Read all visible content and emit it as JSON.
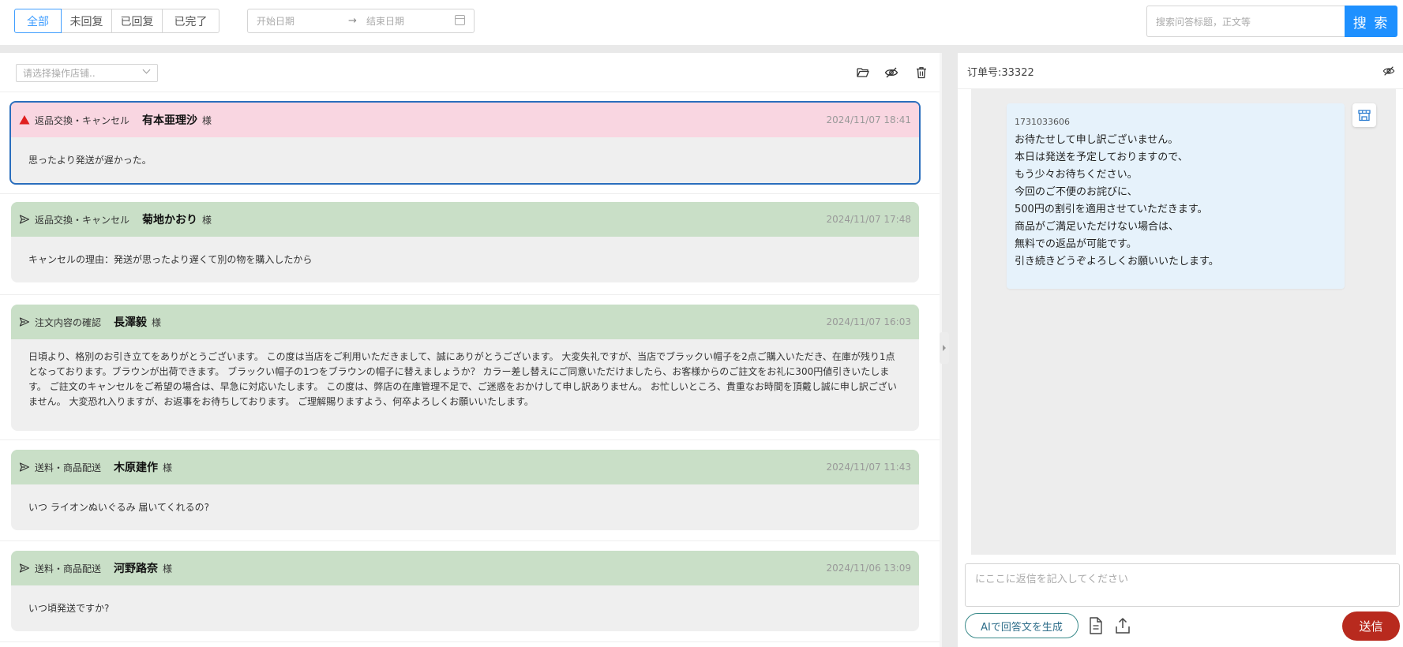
{
  "filters": {
    "tabs": [
      {
        "label": "全部"
      },
      {
        "label": "未回复"
      },
      {
        "label": "已回复"
      },
      {
        "label": "已完了"
      }
    ],
    "date_start_placeholder": "开始日期",
    "date_arrow": "→",
    "date_end_placeholder": "结束日期"
  },
  "search": {
    "placeholder": "搜索问答标题，正文等",
    "button_label": "搜 索"
  },
  "left_panel": {
    "shop_select_placeholder": "请选择操作店铺.."
  },
  "messages": [
    {
      "status": "alert",
      "category": "返品交換・キャンセル",
      "customer": "有本亜理沙",
      "honorific": "様",
      "time": "2024/11/07 18:41",
      "body": "思ったより発送が遅かった。",
      "selected": true
    },
    {
      "status": "sent",
      "category": "返品交換・キャンセル",
      "customer": "菊地かおり",
      "honorific": "様",
      "time": "2024/11/07 17:48",
      "body": "キャンセルの理由：発送が思ったより遅くて別の物を購入したから",
      "selected": false
    },
    {
      "status": "sent",
      "category": "注文内容の確認",
      "customer": "長澤毅",
      "honorific": "様",
      "time": "2024/11/07 16:03",
      "body": "日頃より、格別のお引き立てをありがとうございます。 この度は当店をご利用いただきまして、誠にありがとうございます。 大変失礼ですが、当店でブラックい帽子を2点ご購入いただき、在庫が残り1点となっております。ブラウンが出荷できます。 ブラックい帽子の1つをブラウンの帽子に替えましょうか？ カラー差し替えにご同意いただけましたら、お客様からのご註文をお礼に300円値引きいたします。 ご註文のキャンセルをご希望の場合は、早急に対応いたします。 この度は、弊店の在庫管理不足で、ご迷惑をおかけして申し訳ありません。 お忙しいところ、貴重なお時間を頂戴し誠に申し訳ございません。 大変恐れ入りますが、お返事をお待ちしております。 ご理解賜りますよう、何卒よろしくお願いいたします。",
      "selected": false
    },
    {
      "status": "sent",
      "category": "送料・商品配送",
      "customer": "木原建作",
      "honorific": "様",
      "time": "2024/11/07 11:43",
      "body": "いつ ライオンぬいぐるみ 届いてくれるの?",
      "selected": false
    },
    {
      "status": "sent",
      "category": "送料・商品配送",
      "customer": "河野路奈",
      "honorific": "様",
      "time": "2024/11/06 13:09",
      "body": "いつ頃発送ですか?",
      "selected": false
    }
  ],
  "detail": {
    "order_label": "订单号:33322",
    "bubble_id": "1731033606",
    "bubble_lines": [
      "お待たせして申し訳ございません。",
      "本日は発送を予定しておりますので、",
      "もう少々お待ちください。",
      "今回のご不便のお詫びに、",
      "500円の割引を適用させていただきます。",
      "商品がご満足いただけない場合は、",
      "無料での返品が可能です。",
      "引き続きどうぞよろしくお願いいたします。"
    ],
    "reply_placeholder": "にここに返信を記入してください",
    "ai_button": "AIで回答文を生成",
    "send_button": "送信"
  },
  "colors": {
    "accent": "#409eff",
    "search_button": "#1e90ff",
    "alert_header": "#f9d6e1",
    "sent_header": "#c9dfc7",
    "selected_border": "#2a6ebd",
    "send_button": "#b82a1e",
    "bubble": "#e6f2fb"
  },
  "icons": {
    "toolbar": [
      "folder-open-icon",
      "eye-off-icon",
      "trash-icon"
    ],
    "status": {
      "alert": "warning-triangle-icon",
      "sent": "paper-plane-icon"
    },
    "detail": [
      "eye-off-icon",
      "store-icon",
      "document-icon",
      "upload-icon"
    ]
  }
}
